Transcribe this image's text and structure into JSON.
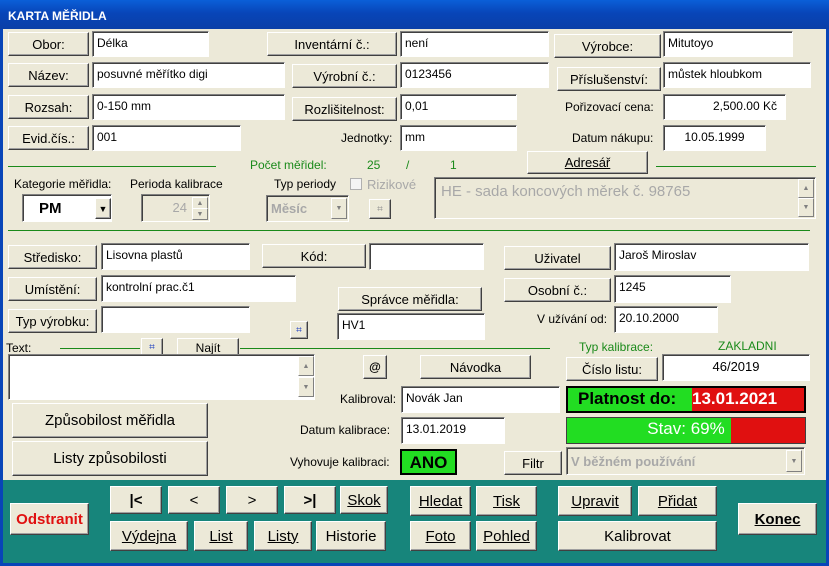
{
  "window": {
    "title": "KARTA MĚŘIDLA"
  },
  "fields": {
    "obor": {
      "label": "Obor:",
      "value": "Délka"
    },
    "nazev": {
      "label": "Název:",
      "value": "posuvné měřítko digi"
    },
    "rozsah": {
      "label": "Rozsah:",
      "value": "0-150 mm"
    },
    "evid": {
      "label": "Evid.čís.:",
      "value": "001"
    },
    "inventarni": {
      "label": "Inventární č.:",
      "value": "není"
    },
    "vyrobni": {
      "label": "Výrobní č.:",
      "value": "0123456"
    },
    "rozlisitelnost": {
      "label": "Rozlišitelnost:",
      "value": "0,01"
    },
    "jednotky": {
      "label": "Jednotky:",
      "value": "mm"
    },
    "vyrobce": {
      "label": "Výrobce:",
      "value": "Mitutoyo"
    },
    "prislusenstvi": {
      "label": "Příslušenství:",
      "value": "můstek hloubkom"
    },
    "porizovaci_cena": {
      "label": "Pořizovací cena:",
      "value": "2,500.00 Kč"
    },
    "datum_nakupu": {
      "label": "Datum nákupu:",
      "value": "10.05.1999"
    }
  },
  "counts": {
    "label": "Počet měřidel:",
    "total": "25",
    "sep": "/",
    "current": "1"
  },
  "adresar": "Adresář",
  "kategorie": {
    "label": "Kategorie měřidla:",
    "value": "PM"
  },
  "perioda": {
    "label": "Perioda kalibrace",
    "value": "24"
  },
  "typ_periody": {
    "label": "Typ periody",
    "value": "Měsíc"
  },
  "rizikove": {
    "label": "Rizikové"
  },
  "note": "HE - sada koncových měrek č. 98765",
  "org": {
    "stredisko": {
      "label": "Středisko:",
      "value": "Lisovna plastů"
    },
    "umisteni": {
      "label": "Umístění:",
      "value": "kontrolní prac.č1"
    },
    "typ_vyrobku": {
      "label": "Typ výrobku:",
      "value": ""
    },
    "kod": {
      "label": "Kód:",
      "value": ""
    },
    "spravce": {
      "label": "Správce měřidla:",
      "value": "HV1"
    },
    "uzivatel": {
      "label": "Uživatel",
      "value": "Jaroš Miroslav"
    },
    "osobni": {
      "label": "Osobní č.:",
      "value": "1245"
    },
    "v_uzivani": {
      "label": "V užívání od:",
      "value": "20.10.2000"
    }
  },
  "text_section": {
    "label": "Text:",
    "najit": "Najít"
  },
  "navodka": "Návodka",
  "attach_icon": "@",
  "kalibrace": {
    "typ_label": "Typ kalibrace:",
    "typ_value": "ZAKLADNI",
    "cislo_listu_label": "Číslo listu:",
    "cislo_listu_value": "46/2019",
    "kalibroval_label": "Kalibroval:",
    "kalibroval_value": "Novák Jan",
    "datum_label": "Datum kalibrace:",
    "datum_value": "13.01.2019",
    "vyhovuje_label": "Vyhovuje kalibraci:",
    "vyhovuje_value": "ANO",
    "platnost_label": "Platnost do:",
    "platnost_value": "13.01.2021",
    "stav_label": "Stav: 69%",
    "stav_pct": 69,
    "filtr": "Filtr",
    "filtr_value": "V běžném používání"
  },
  "buttons": {
    "zpusobilost": "Způsobilost měřidla",
    "listy_zpusobilosti": "Listy způsobilosti"
  },
  "footer": {
    "odstranit": "Odstranit",
    "first": "|<",
    "prev": "<",
    "next": ">",
    "last": ">|",
    "skok": "Skok",
    "hledat": "Hledat",
    "tisk": "Tisk",
    "upravit": "Upravit",
    "pridat": "Přidat",
    "konec": "Konec",
    "vydejna": "Výdejna",
    "list": "List",
    "listy": "Listy",
    "historie": "Historie",
    "foto": "Foto",
    "pohled": "Pohled",
    "kalibrovat": "Kalibrovat"
  },
  "colors": {
    "accent_green": "#1a8a1a",
    "footer_bg": "#17857b",
    "status_green": "#22dd22",
    "status_red": "#e01010"
  }
}
